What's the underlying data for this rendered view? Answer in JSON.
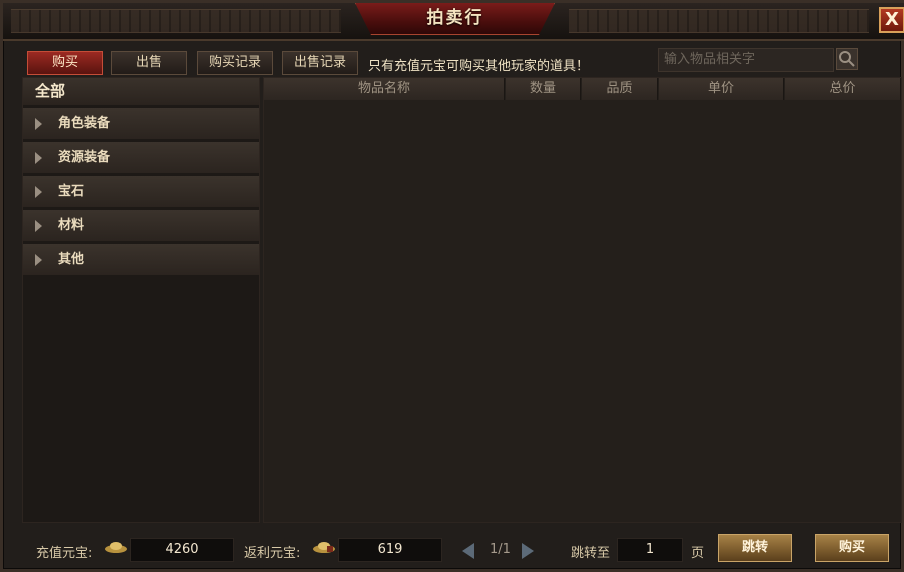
{
  "window": {
    "title": "拍卖行",
    "close_glyph": "X"
  },
  "tabs": [
    {
      "label": "购买",
      "active": true
    },
    {
      "label": "出售",
      "active": false
    },
    {
      "label": "购买记录",
      "active": false
    },
    {
      "label": "出售记录",
      "active": false
    }
  ],
  "notice": "只有充值元宝可购买其他玩家的道具！",
  "search": {
    "placeholder": "输入物品相关字"
  },
  "categories": {
    "all": "全部",
    "items": [
      {
        "label": "角色装备"
      },
      {
        "label": "资源装备"
      },
      {
        "label": "宝石"
      },
      {
        "label": "材料"
      },
      {
        "label": "其他"
      }
    ]
  },
  "table": {
    "columns": [
      "物品名称",
      "数量",
      "品质",
      "单价",
      "总价"
    ],
    "rows": []
  },
  "footer": {
    "recharge_label": "充值元宝:",
    "recharge_value": "4260",
    "rebate_label": "返利元宝:",
    "rebate_value": "619",
    "page": "1/1",
    "jump_label": "跳转至",
    "jump_value": "1",
    "page_unit": "页",
    "jump_button": "跳转",
    "buy_button": "购买"
  },
  "colors": {
    "accent_red": "#9b2a22",
    "gold": "#a78247",
    "background": "#221e1b"
  }
}
